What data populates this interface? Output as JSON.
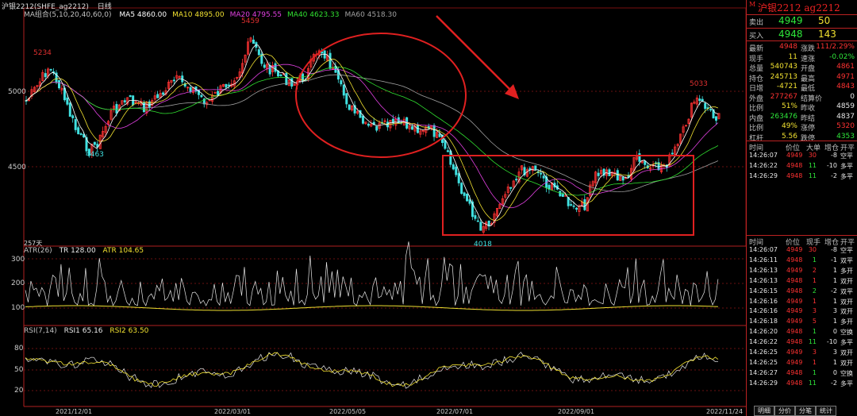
{
  "header": {
    "title_mark": "",
    "instrument": "沪银2212",
    "instrument_suffix": "(SHFE_ag2212)",
    "period": "日线"
  },
  "ma_legend": {
    "label": "MA组合(5,10,20,40,60,0)",
    "items": [
      {
        "text": "MA5 4860.00",
        "color": "#ffffff"
      },
      {
        "text": "MA10 4895.00",
        "color": "#f0e030"
      },
      {
        "text": "MA20 4795.55",
        "color": "#e040e0"
      },
      {
        "text": "MA40 4623.33",
        "color": "#30e030"
      },
      {
        "text": "MA60 4518.30",
        "color": "#a0a0a0"
      }
    ]
  },
  "price_axis": [
    "5000",
    "4500"
  ],
  "price_annotations": {
    "high1": "5234",
    "high2": "5459",
    "low1": "4463",
    "low2": "4018",
    "high3": "5033",
    "bars_count": "257天"
  },
  "atr_legend": {
    "label": "ATR(26)",
    "tr": "TR 128.00",
    "atr": "ATR 104.65"
  },
  "atr_axis": [
    "300",
    "200",
    "100"
  ],
  "rsi_legend": {
    "label": "RSI(7,14)",
    "rsi1": "RSI1 65.16",
    "rsi2": "RSI2 63.50"
  },
  "rsi_axis": [
    "80",
    "50",
    "20"
  ],
  "date_axis": [
    "2021/12/01",
    "2022/03/01",
    "2022/05/05",
    "2022/07/01",
    "2022/09/01",
    "2022/11/24"
  ],
  "colors": {
    "up": "#ff3232",
    "down": "#40e0e0",
    "ma5": "#ffffff",
    "ma10": "#f0e030",
    "ma20": "#e040e0",
    "ma40": "#30e030",
    "ma60": "#a0a0a0",
    "annot": "#e02020"
  },
  "quote_panel": {
    "title": "沪银2212  ag2212",
    "sell": {
      "label": "卖出",
      "price": "4949",
      "volume": "50"
    },
    "buy": {
      "label": "买入",
      "price": "4948",
      "volume": "143"
    },
    "stats": [
      {
        "l1": "最新",
        "v1": "4948",
        "c1": "red",
        "l2": "涨跌",
        "v2": "111/2.29%",
        "c2": "red"
      },
      {
        "l1": "现手",
        "v1": "11",
        "c1": "yellow",
        "l2": "速涨",
        "v2": "-0.02%",
        "c2": "green"
      },
      {
        "l1": "总量",
        "v1": "540743",
        "c1": "yellow",
        "l2": "开盘",
        "v2": "4861",
        "c2": "red"
      },
      {
        "l1": "持仓",
        "v1": "245713",
        "c1": "yellow",
        "l2": "最高",
        "v2": "4971",
        "c2": "red"
      },
      {
        "l1": "日增",
        "v1": "-4721",
        "c1": "yellow",
        "l2": "最低",
        "v2": "4843",
        "c2": "red"
      },
      {
        "l1": "外盘",
        "v1": "277267",
        "c1": "red",
        "l2": "结算价",
        "v2": "0",
        "c2": "white"
      },
      {
        "l1": "比例",
        "v1": "51%",
        "c1": "yellow",
        "l2": "昨收",
        "v2": "4859",
        "c2": "white"
      },
      {
        "l1": "内盘",
        "v1": "263476",
        "c1": "green",
        "l2": "昨结",
        "v2": "4837",
        "c2": "white"
      },
      {
        "l1": "比例",
        "v1": "49%",
        "c1": "yellow",
        "l2": "涨停",
        "v2": "5320",
        "c2": "red"
      },
      {
        "l1": "杠杆",
        "v1": "5.56",
        "c1": "yellow",
        "l2": "跌停",
        "v2": "4353",
        "c2": "green"
      }
    ],
    "tick_header1": {
      "time": "时间",
      "price": "价位",
      "qty": "大单",
      "chg": "增仓",
      "dir": "开平"
    },
    "ticks1": [
      {
        "time": "14:26:07",
        "price": "4949",
        "qty": "30",
        "chg": "-8",
        "dir": "空平"
      },
      {
        "time": "14:26:22",
        "price": "4948",
        "qty": "11",
        "chg": "-10",
        "dir": "多平"
      },
      {
        "time": "14:26:29",
        "price": "4948",
        "qty": "11",
        "chg": "-2",
        "dir": "多平"
      }
    ],
    "tick_header2": {
      "time": "时间",
      "price": "价位",
      "qty": "现手",
      "chg": "增仓",
      "dir": "开平"
    },
    "ticks2": [
      {
        "time": "14:26:07",
        "price": "4949",
        "qty": "30",
        "chg": "-8",
        "dir": "空平"
      },
      {
        "time": "14:26:11",
        "price": "4948",
        "qty": "1",
        "chg": "-1",
        "dir": "双平"
      },
      {
        "time": "14:26:13",
        "price": "4949",
        "qty": "2",
        "chg": "1",
        "dir": "多开"
      },
      {
        "time": "14:26:13",
        "price": "4948",
        "qty": "1",
        "chg": "1",
        "dir": "双开"
      },
      {
        "time": "14:26:15",
        "price": "4948",
        "qty": "2",
        "chg": "-2",
        "dir": "双平"
      },
      {
        "time": "14:26:16",
        "price": "4949",
        "qty": "1",
        "chg": "1",
        "dir": "双开"
      },
      {
        "time": "14:26:16",
        "price": "4949",
        "qty": "3",
        "chg": "3",
        "dir": "双开"
      },
      {
        "time": "14:26:18",
        "price": "4949",
        "qty": "5",
        "chg": "1",
        "dir": "多开"
      },
      {
        "time": "14:26:20",
        "price": "4948",
        "qty": "1",
        "chg": "0",
        "dir": "空换"
      },
      {
        "time": "14:26:22",
        "price": "4948",
        "qty": "11",
        "chg": "-10",
        "dir": "多平"
      },
      {
        "time": "14:26:25",
        "price": "4949",
        "qty": "3",
        "chg": "3",
        "dir": "双开"
      },
      {
        "time": "14:26:25",
        "price": "4949",
        "qty": "1",
        "chg": "1",
        "dir": "双开"
      },
      {
        "time": "14:26:27",
        "price": "4948",
        "qty": "1",
        "chg": "0",
        "dir": "空换"
      },
      {
        "time": "14:26:29",
        "price": "4948",
        "qty": "11",
        "chg": "-2",
        "dir": "多平"
      }
    ],
    "tabs": [
      "明细",
      "分价",
      "分笔",
      "统计"
    ]
  }
}
